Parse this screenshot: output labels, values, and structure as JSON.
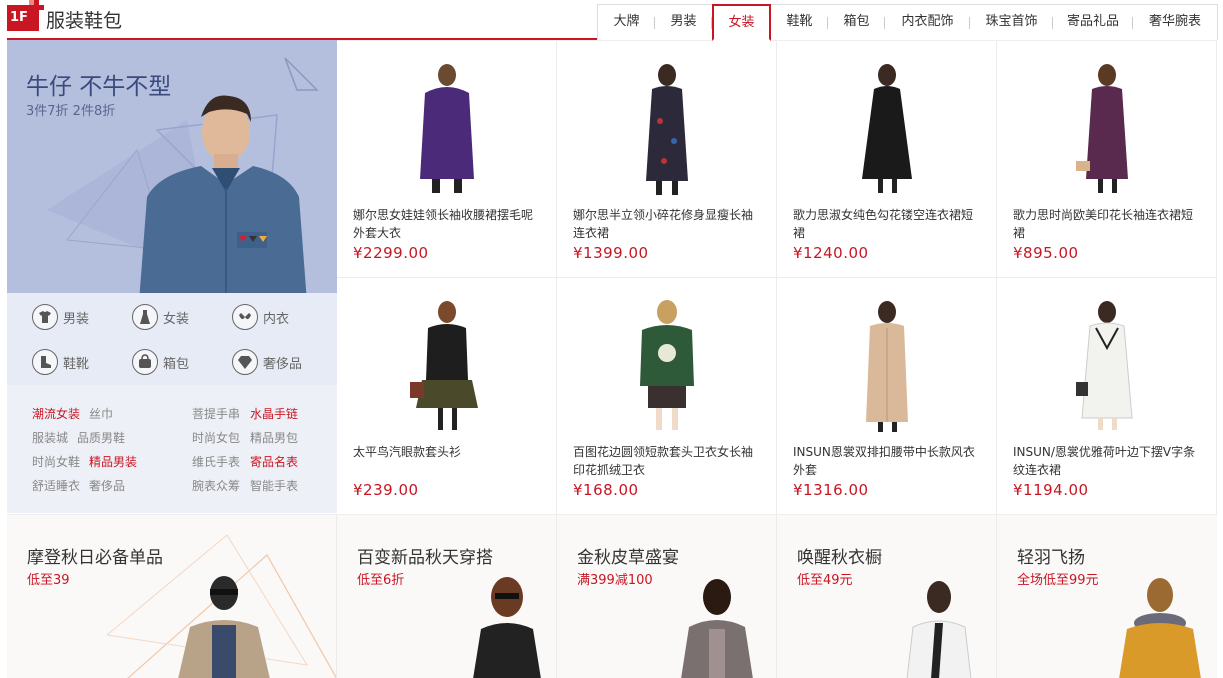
{
  "floor": {
    "badge": "1F",
    "title": "服装鞋包"
  },
  "tabs": [
    {
      "label": "大牌"
    },
    {
      "label": "男装"
    },
    {
      "label": "女装"
    },
    {
      "label": "鞋靴"
    },
    {
      "label": "箱包"
    },
    {
      "label": "内衣配饰"
    },
    {
      "label": "珠宝首饰"
    },
    {
      "label": "寄品礼品"
    },
    {
      "label": "奢华腕表"
    }
  ],
  "active_tab": "女装",
  "promo": {
    "title": "牛仔 不牛不型",
    "subtitle": "3件7折 2件8折"
  },
  "categories": [
    {
      "label": "男装",
      "icon": "tshirt-icon"
    },
    {
      "label": "女装",
      "icon": "dress-icon"
    },
    {
      "label": "内衣",
      "icon": "bra-icon"
    },
    {
      "label": "鞋靴",
      "icon": "boot-icon"
    },
    {
      "label": "箱包",
      "icon": "bag-icon"
    },
    {
      "label": "奢侈品",
      "icon": "diamond-icon"
    }
  ],
  "links": [
    {
      "label": "潮流女装",
      "highlight": true
    },
    {
      "label": "丝巾",
      "highlight": false
    },
    {
      "label": "菩提手串",
      "highlight": false
    },
    {
      "label": "水晶手链",
      "highlight": true
    },
    {
      "label": "服装城",
      "highlight": false
    },
    {
      "label": "品质男鞋",
      "highlight": false
    },
    {
      "label": "时尚女包",
      "highlight": false
    },
    {
      "label": "精品男包",
      "highlight": false
    },
    {
      "label": "时尚女鞋",
      "highlight": false
    },
    {
      "label": "精品男装",
      "highlight": true
    },
    {
      "label": "维氏手表",
      "highlight": false
    },
    {
      "label": "寄品名表",
      "highlight": true
    },
    {
      "label": "舒适睡衣",
      "highlight": false
    },
    {
      "label": "奢侈品",
      "highlight": false
    },
    {
      "label": "腕表众筹",
      "highlight": false
    },
    {
      "label": "智能手表",
      "highlight": false
    }
  ],
  "products": [
    {
      "name": "娜尔思女娃娃领长袖收腰裙摆毛呢外套大衣",
      "price": "¥2299.00",
      "color": "#4b2a7a"
    },
    {
      "name": "娜尔思半立领小碎花修身显瘦长袖连衣裙",
      "price": "¥1399.00",
      "color": "#2c2a3a"
    },
    {
      "name": "歌力思淑女纯色勾花镂空连衣裙短裙",
      "price": "¥1240.00",
      "color": "#1a1a1a"
    },
    {
      "name": "歌力思时尚欧美印花长袖连衣裙短裙",
      "price": "¥895.00",
      "color": "#5a2a4e"
    },
    {
      "name": "太平鸟汽眼款套头衫",
      "price": "¥239.00",
      "color": "#1e1e1e"
    },
    {
      "name": "百图花边圆领短款套头卫衣女长袖印花抓绒卫衣",
      "price": "¥168.00",
      "color": "#2e5a3a"
    },
    {
      "name": "INSUN恩裳双排扣腰带中长款风衣外套",
      "price": "¥1316.00",
      "color": "#d9b99a"
    },
    {
      "name": "INSUN/恩裳优雅荷叶边下摆V字条纹连衣裙",
      "price": "¥1194.00",
      "color": "#f2f2ee"
    }
  ],
  "bottom_banners": [
    {
      "title": "摩登秋日必备单品",
      "sub": "低至39",
      "color": "#b8a389"
    },
    {
      "title": "百变新品秋天穿搭",
      "sub": "低至6折",
      "color": "#222222"
    },
    {
      "title": "金秋皮草盛宴",
      "sub": "满399减100",
      "color": "#7a7070"
    },
    {
      "title": "唤醒秋衣橱",
      "sub": "低至49元",
      "color": "#f2f2f2"
    },
    {
      "title": "轻羽飞扬",
      "sub": "全场低至99元",
      "color": "#d99a2a"
    }
  ]
}
